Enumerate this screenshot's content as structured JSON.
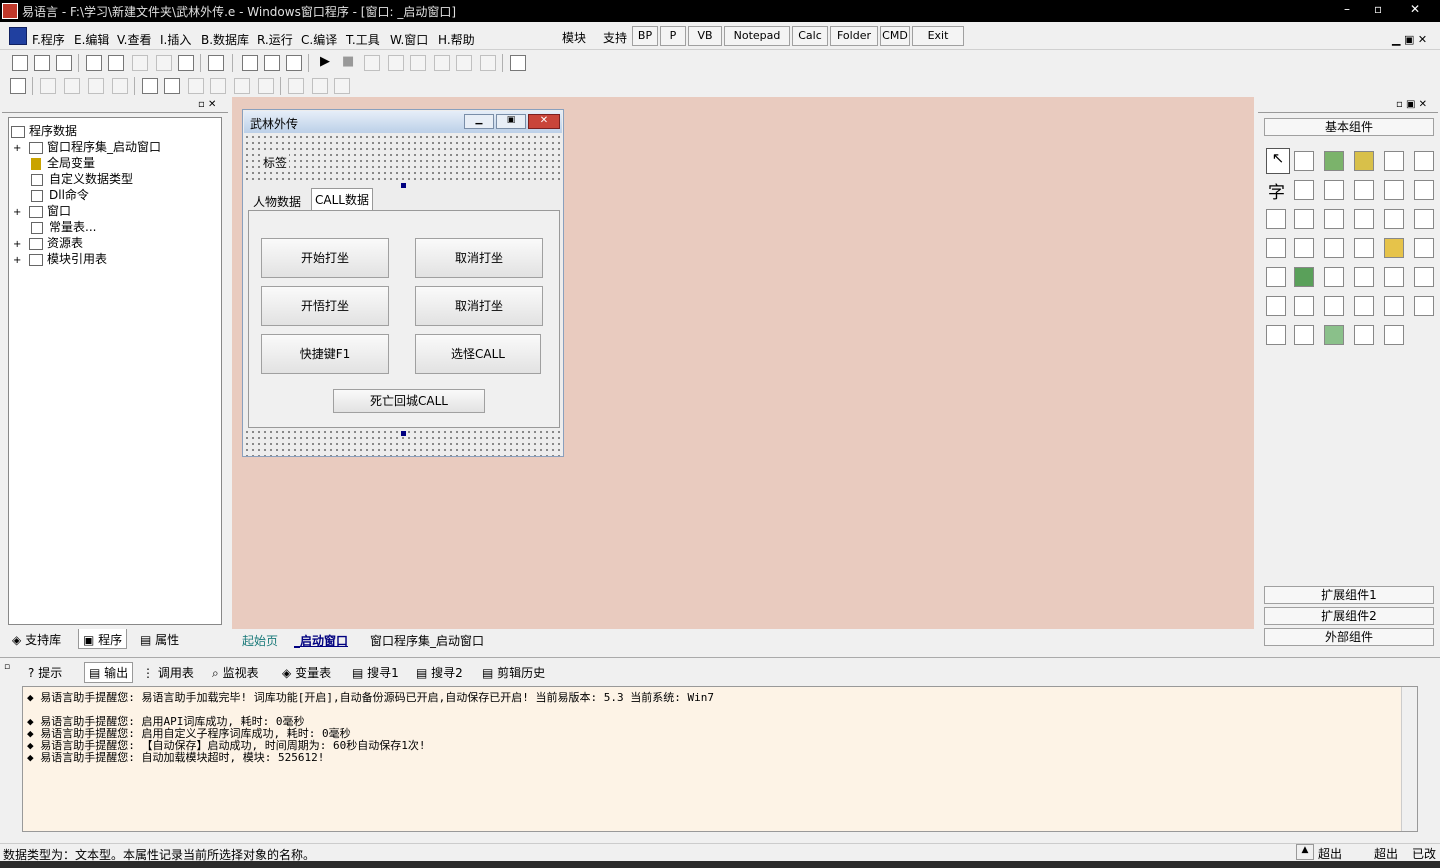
{
  "app": {
    "title": "易语言 - F:\\学习\\新建文件夹\\武林外传.e - Windows窗口程序 - [窗口: _启动窗口]",
    "window_controls": [
      "–",
      "▫",
      "✕"
    ]
  },
  "menu": {
    "items": [
      "F.程序",
      "E.编辑",
      "V.查看",
      "I.插入",
      "B.数据库",
      "R.运行",
      "C.编译",
      "T.工具",
      "W.窗口",
      "H.帮助"
    ],
    "extras": [
      "模块",
      "支持"
    ],
    "quick_buttons": [
      "BP",
      "P",
      "VB",
      "Notepad",
      "Calc",
      "Folder",
      "CMD",
      "Exit"
    ]
  },
  "left_panel": {
    "tree": [
      {
        "label": "程序数据",
        "expander": ""
      },
      {
        "label": "窗口程序集_启动窗口",
        "expander": "+"
      },
      {
        "label": "全局变量",
        "expander": ""
      },
      {
        "label": "自定义数据类型",
        "expander": ""
      },
      {
        "label": "Dll命令",
        "expander": ""
      },
      {
        "label": "窗口",
        "expander": "+"
      },
      {
        "label": "常量表...",
        "expander": ""
      },
      {
        "label": "资源表",
        "expander": "+"
      },
      {
        "label": "模块引用表",
        "expander": "+"
      }
    ],
    "tabs": [
      "支持库",
      "程序",
      "属性"
    ]
  },
  "form": {
    "title": "武林外传",
    "label": "标签",
    "tabs": [
      "人物数据",
      "CALL数据"
    ],
    "buttons": [
      {
        "label": "开始打坐"
      },
      {
        "label": "取消打坐"
      },
      {
        "label": "开悟打坐"
      },
      {
        "label": "取消打坐"
      },
      {
        "label": "快捷键F1"
      },
      {
        "label": "选怪CALL"
      }
    ],
    "bottom_button": "死亡回城CALL"
  },
  "doc_tabs": [
    "起始页",
    "_启动窗口",
    "窗口程序集_启动窗口"
  ],
  "palette": {
    "header": "基本组件",
    "footer_groups": [
      "扩展组件1",
      "扩展组件2",
      "外部组件"
    ]
  },
  "output_tabs": [
    "提示",
    "输出",
    "调用表",
    "监视表",
    "变量表",
    "搜寻1",
    "搜寻2",
    "剪辑历史"
  ],
  "output_lines": [
    "◆ 易语言助手提醒您:  易语言助手加载完毕!  词库功能[开启],自动备份源码已开启,自动保存已开启!  当前易版本: 5.3  当前系统: Win7",
    "",
    "◆ 易语言助手提醒您: 启用API词库成功, 耗时: 0毫秒",
    "◆ 易语言助手提醒您: 启用自定义子程序词库成功, 耗时: 0毫秒",
    "◆ 易语言助手提醒您: 【自动保存】启动成功, 时间周期为: 60秒自动保存1次!",
    "◆ 易语言助手提醒您: 自动加载模块超时, 模块: 525612!"
  ],
  "status": {
    "text": "数据类型为：文本型。本属性记录当前所选择对象的名称。",
    "right": [
      "超出",
      "超出",
      "已改"
    ]
  },
  "colors": {
    "design_bg": "#e9cbbf",
    "output_bg": "#fdf3e6"
  }
}
